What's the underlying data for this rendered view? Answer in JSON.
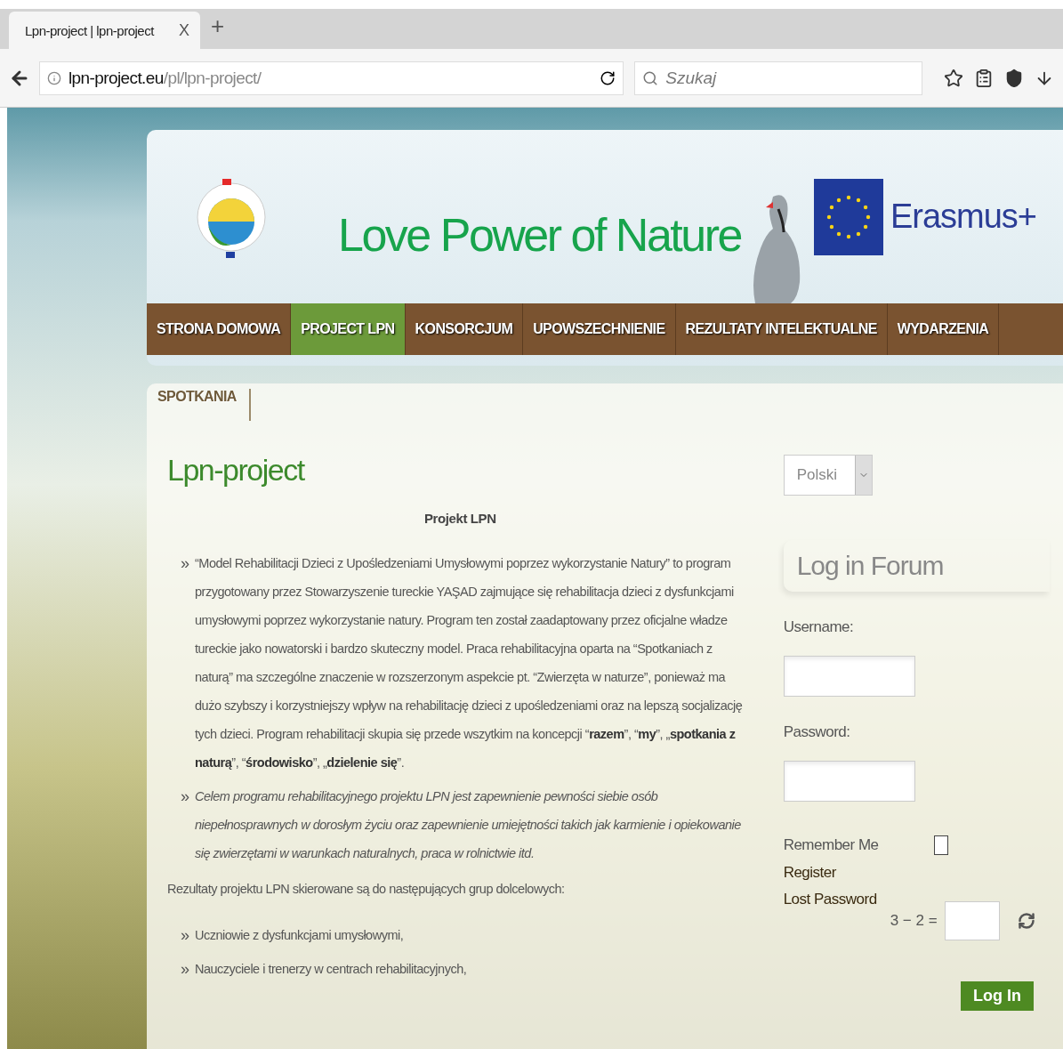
{
  "browser": {
    "tab": {
      "title": "Lpn-project | lpn-project",
      "close": "X"
    },
    "new_tab": "+",
    "address": {
      "domain": "lpn-project.eu",
      "path": "/pl/lpn-project/"
    },
    "search": {
      "placeholder": "Szukaj"
    }
  },
  "header": {
    "title": "Love Power of Nature",
    "erasmus": "Erasmus+"
  },
  "nav": [
    {
      "label": "STRONA DOMOWA",
      "selected": false
    },
    {
      "label": "PROJECT LPN",
      "selected": true
    },
    {
      "label": "KONSORCJUM",
      "selected": false
    },
    {
      "label": "UPOWSZECHNIENIE",
      "selected": false
    },
    {
      "label": "REZULTATY INTELEKTUALNE",
      "selected": false
    },
    {
      "label": "WYDARZENIA",
      "selected": false
    }
  ],
  "subnav": [
    "SPOTKANIA"
  ],
  "content": {
    "title": "Lpn-project",
    "heading": "Projekt LPN",
    "bullet_marker": "»",
    "bullets": [
      {
        "text": "“Model Rehabilitacji Dzieci z Upośledzeniami Umysłowymi poprzez wykorzystanie Natury” to program przygotowany przez Stowarzyszenie tureckie YAŞAD zajmujące się rehabilitacja dzieci z dysfunkcjami umysłowymi poprzez wykorzystanie natury. Program ten został zaadaptowany przez oficjalne władze tureckie jako nowatorski i bardzo skuteczny model. Praca rehabilitacyjna oparta na “Spotkaniach z naturą” ma szczególne znaczenie w rozszerzonym aspekcie pt. “Zwierzęta w naturze”, ponieważ ma dużo szybszy i korzystniejszy wpływ na rehabilitację dzieci z upośledzeniami oraz na lepszą socjalizację tych dzieci. Program rehabilitacji skupia się przede wszytkim na koncepcji “**razem**”, “**my**”, „**spotkania z naturą**”, “**środowisko**”, „**dzielenie się**”.",
        "italic": false
      },
      {
        "text": "Celem programu rehabilitacyjnego projektu LPN jest zapewnienie pewności siebie osób niepełnosprawnych w dorosłym życiu oraz zapewnienie umiejętności takich jak karmienie i opiekowanie się zwierzętami w warunkach naturalnych, praca w rolnictwie itd.",
        "italic": true
      }
    ],
    "intro": "Rezultaty projektu LPN skierowane są do następujących grup dolcelowych:",
    "groups": [
      "Uczniowie z dysfunkcjami umysłowymi,",
      "Nauczyciele i trenerzy w centrach rehabilitacyjnych,"
    ]
  },
  "sidebar": {
    "language": "Polski",
    "login_title": "Log in Forum",
    "username_label": "Username:",
    "password_label": "Password:",
    "remember": {
      "label": "Remember Me",
      "checked": false
    },
    "links": [
      "Register",
      "Lost Password"
    ],
    "captcha": "3 − 2 =",
    "submit": "Log In"
  }
}
